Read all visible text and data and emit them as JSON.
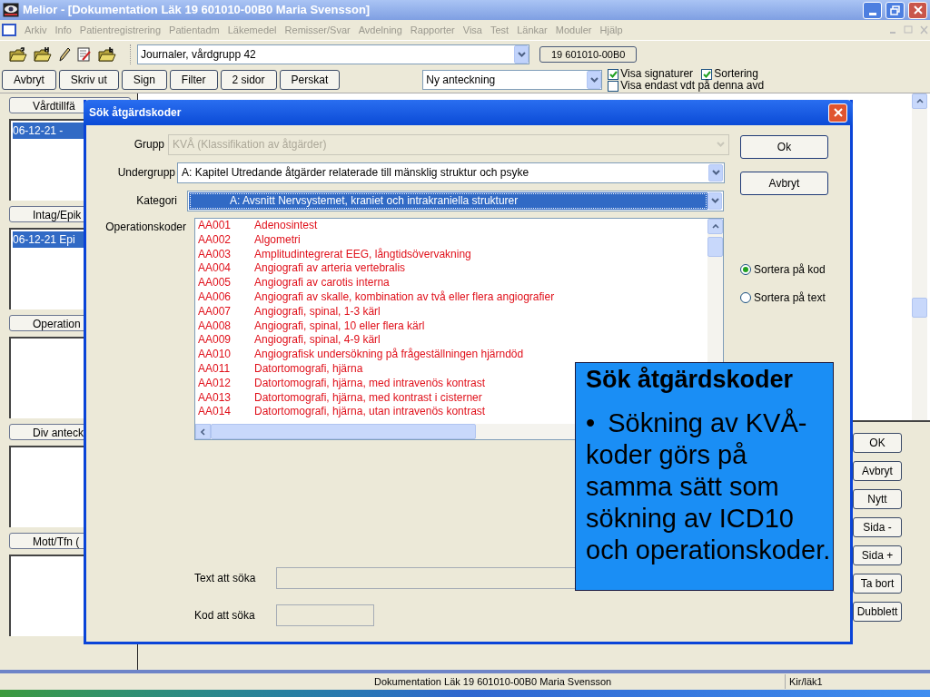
{
  "window": {
    "title": "Melior - [Dokumentation Läk 19 601010-00B0 Maria Svensson]"
  },
  "menu": [
    "Arkiv",
    "Info",
    "Patientregistrering",
    "Patientadm",
    "Läkemedel",
    "Remisser/Svar",
    "Avdelning",
    "Rapporter",
    "Visa",
    "Test",
    "Länkar",
    "Moduler",
    "Hjälp"
  ],
  "toolbar": {
    "journal_combo": "Journaler, vårdgrupp 42",
    "patient_id": "19 601010-00B0"
  },
  "actions": [
    "Avbryt",
    "Skriv ut",
    "Sign",
    "Filter",
    "2 sidor",
    "Perskat"
  ],
  "note_combo": "Ny anteckning",
  "options": [
    {
      "label": "Visa signaturer",
      "checked": true
    },
    {
      "label": "Sortering",
      "checked": true
    },
    {
      "label": "Visa endast vdt på denna avd",
      "checked": false
    }
  ],
  "sections": [
    {
      "title": "Vårdtillfä",
      "items": [
        {
          "text": "06-12-21 -",
          "selected": true
        }
      ]
    },
    {
      "title": "Intag/Epik",
      "items": [
        {
          "text": "06-12-21  Epi",
          "selected": true
        }
      ]
    },
    {
      "title": "Operation"
    },
    {
      "title": "Div anteck"
    },
    {
      "title": "Mott/Tfn ("
    }
  ],
  "side_buttons": [
    "OK",
    "Avbryt",
    "Nytt",
    "Sida -",
    "Sida +",
    "Ta bort",
    "Dubblett"
  ],
  "dialog": {
    "title": "Sök åtgärdskoder",
    "fields": [
      {
        "label": "Grupp",
        "value": "KVÅ (Klassifikation av åtgärder)",
        "disabled": true,
        "focused": false
      },
      {
        "label": "Undergrupp",
        "value": "A: Kapitel Utredande åtgärder relaterade till mänsklig struktur och psyke",
        "disabled": false,
        "focused": false
      },
      {
        "label": "Kategori",
        "value": "A: Avsnitt Nervsystemet, kraniet och intrakraniella strukturer",
        "disabled": false,
        "focused": true
      }
    ],
    "codes_label": "Operationskoder",
    "codes": [
      {
        "code": "AA001",
        "text": "Adenosintest"
      },
      {
        "code": "AA002",
        "text": "Algometri"
      },
      {
        "code": "AA003",
        "text": "Amplitudintegrerat EEG, långtidsövervakning"
      },
      {
        "code": "AA004",
        "text": "Angiografi av arteria vertebralis"
      },
      {
        "code": "AA005",
        "text": "Angiografi av carotis interna"
      },
      {
        "code": "AA006",
        "text": "Angiografi av skalle, kombination av två eller flera angiografier"
      },
      {
        "code": "AA007",
        "text": "Angiografi, spinal, 1-3 kärl"
      },
      {
        "code": "AA008",
        "text": "Angiografi, spinal, 10 eller flera kärl"
      },
      {
        "code": "AA009",
        "text": "Angiografi, spinal, 4-9 kärl"
      },
      {
        "code": "AA010",
        "text": "Angiografisk undersökning på frågeställningen hjärndöd"
      },
      {
        "code": "AA011",
        "text": "Datortomografi, hjärna"
      },
      {
        "code": "AA012",
        "text": "Datortomografi, hjärna, med intravenös kontrast"
      },
      {
        "code": "AA013",
        "text": "Datortomografi, hjärna, med kontrast i cisterner"
      },
      {
        "code": "AA014",
        "text": "Datortomografi, hjärna, utan intravenös kontrast"
      }
    ],
    "buttons": [
      "Ok",
      "Avbryt"
    ],
    "sort": [
      {
        "label": "Sortera på kod",
        "selected": true
      },
      {
        "label": "Sortera på text",
        "selected": false
      }
    ],
    "search": [
      {
        "label": "Text att söka"
      },
      {
        "label": "Kod att söka"
      }
    ]
  },
  "status_bar": [
    "Dokumentation Läk 19 601010-00B0 Maria Svensson",
    "Kir/läk1"
  ],
  "callout": {
    "title": "Sök åtgärdskoder",
    "bullet": "•",
    "text": "Sökning av KVÅ-koder görs på samma sätt som sökning av ICD10 och operationskoder."
  }
}
